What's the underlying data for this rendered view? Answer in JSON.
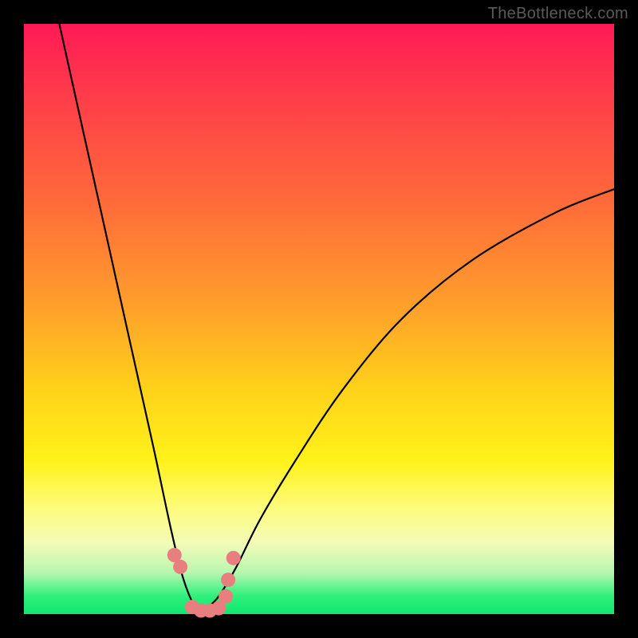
{
  "watermark": "TheBottleneck.com",
  "chart_data": {
    "type": "line",
    "title": "",
    "xlabel": "",
    "ylabel": "",
    "xlim": [
      0,
      100
    ],
    "ylim": [
      0,
      100
    ],
    "note": "V-shaped bottleneck curve over red→yellow→green vertical gradient. x in 0–100, y = bottleneck percent (100 top / 0 bottom). Minimum near x≈30 where y≈0.",
    "series": [
      {
        "name": "bottleneck-curve",
        "x": [
          6,
          10,
          14,
          18,
          22,
          25,
          27,
          29,
          30,
          31,
          33,
          36,
          40,
          46,
          54,
          64,
          76,
          90,
          100
        ],
        "y": [
          100,
          82,
          64,
          46,
          28,
          14,
          6,
          1,
          0,
          1,
          3,
          8,
          16,
          26,
          38,
          50,
          60,
          68,
          72
        ]
      }
    ],
    "markers": {
      "name": "highlight-dots",
      "color": "#e97e7e",
      "x": [
        25.5,
        26.5,
        28.5,
        30.0,
        31.5,
        33.0,
        34.2,
        34.6,
        35.5
      ],
      "y": [
        10.0,
        8.0,
        1.2,
        0.6,
        0.6,
        1.0,
        3.0,
        5.8,
        9.5
      ]
    }
  }
}
